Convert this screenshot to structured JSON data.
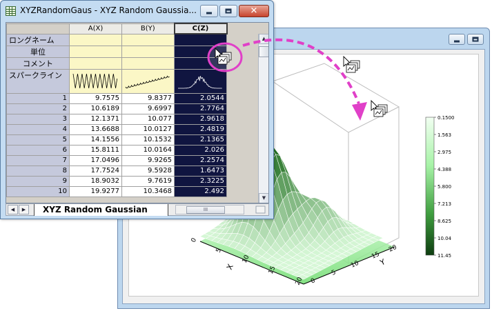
{
  "workbook": {
    "title": "XYZRandomGaus - XYZ Random Gaussia...",
    "columns": [
      "A(X)",
      "B(Y)",
      "C(Z)"
    ],
    "meta_rows": [
      "ロングネーム",
      "単位",
      "コメント"
    ],
    "sparkline_label": "スパークライン",
    "rows": [
      {
        "n": "1",
        "a": "9.7575",
        "b": "9.8377",
        "c": "2.0544"
      },
      {
        "n": "2",
        "a": "10.6189",
        "b": "9.6997",
        "c": "2.7764"
      },
      {
        "n": "3",
        "a": "12.1371",
        "b": "10.077",
        "c": "2.9618"
      },
      {
        "n": "4",
        "a": "13.6688",
        "b": "10.0127",
        "c": "2.4819"
      },
      {
        "n": "5",
        "a": "14.1556",
        "b": "10.1532",
        "c": "2.1365"
      },
      {
        "n": "6",
        "a": "15.8111",
        "b": "10.0164",
        "c": "2.026"
      },
      {
        "n": "7",
        "a": "17.0496",
        "b": "9.9265",
        "c": "2.2574"
      },
      {
        "n": "8",
        "a": "17.7524",
        "b": "9.5928",
        "c": "1.6473"
      },
      {
        "n": "9",
        "a": "18.9032",
        "b": "9.7619",
        "c": "2.3225"
      },
      {
        "n": "10",
        "a": "19.9277",
        "b": "10.3468",
        "c": "2.492"
      }
    ],
    "sheet_tab": "XYZ Random Gaussian"
  },
  "graph": {
    "colorbar_labels": [
      "0.1500",
      "1.563",
      "2.975",
      "4.388",
      "5.800",
      "7.213",
      "8.625",
      "10.04",
      "11.45"
    ],
    "x_axis": {
      "label": "X",
      "ticks": [
        "0",
        "5",
        "10",
        "15",
        "20"
      ]
    },
    "y_axis": {
      "label": "Y",
      "ticks": [
        "0",
        "5",
        "10",
        "15",
        "20"
      ]
    },
    "colors": {
      "surface_dark": "#1b5e20",
      "surface_light": "#e8ffe8",
      "drag_arrow": "#e040c8"
    }
  },
  "icons": [
    "spreadsheet-icon",
    "minimize-icon",
    "maximize-icon",
    "close-icon",
    "drag-cursor-icon",
    "graph-copy-icon"
  ]
}
